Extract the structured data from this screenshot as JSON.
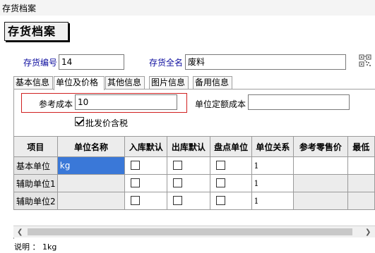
{
  "window": {
    "title": "存货档案"
  },
  "header": {
    "button_label": "存货档案"
  },
  "form": {
    "code_label": "存货编号",
    "code_value": "14",
    "name_label": "存货全名",
    "name_value": "废料"
  },
  "tabs": [
    {
      "label": "基本信息",
      "active": false
    },
    {
      "label": "单位及价格",
      "active": true
    },
    {
      "label": "其他信息",
      "active": false
    },
    {
      "label": "图片信息",
      "active": false
    },
    {
      "label": "备用信息",
      "active": false
    }
  ],
  "price": {
    "ref_cost_label": "参考成本",
    "ref_cost_value": "10",
    "std_cost_label": "单位定额成本",
    "std_cost_value": "",
    "wholesale_tax_label": "批发价含税",
    "wholesale_tax_checked": true
  },
  "grid": {
    "columns": [
      "项目",
      "单位名称",
      "入库默认",
      "出库默认",
      "盘点单位",
      "单位关系",
      "参考零售价",
      "最低"
    ],
    "rows": [
      {
        "item": "基本单位",
        "unit_name": "kg",
        "in_default": false,
        "out_default": false,
        "count_unit": false,
        "relation": "1",
        "retail": ""
      },
      {
        "item": "辅助单位1",
        "unit_name": "",
        "in_default": false,
        "out_default": false,
        "count_unit": false,
        "relation": "1",
        "retail": ""
      },
      {
        "item": "辅助单位2",
        "unit_name": "",
        "in_default": false,
        "out_default": false,
        "count_unit": false,
        "relation": "1",
        "retail": ""
      }
    ]
  },
  "status": {
    "text": "说明 ： 1kg"
  },
  "icons": {
    "qr": "qr-code-icon",
    "scroll_left": "scroll-left-icon",
    "scroll_right": "scroll-right-icon"
  },
  "colors": {
    "label_blue": "#1010a0",
    "selection": "#3a78d8",
    "highlight_border": "#d02020"
  }
}
